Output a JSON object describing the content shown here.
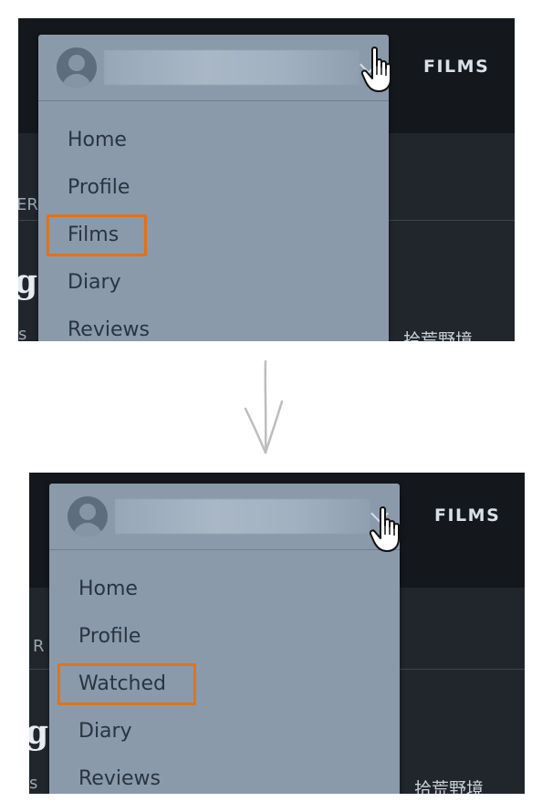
{
  "colors": {
    "highlight_outline": "#e0731a",
    "dropdown_background": "#8a9aab",
    "header_background": "#14181c",
    "arrow": "#bdbdbd"
  },
  "before": {
    "nav": {
      "films_label": "FILMS"
    },
    "background_fragments": {
      "left_edge_text": "ER",
      "big_glyph": "g",
      "small_text": "s",
      "cjk_text": "拾荒野境"
    },
    "account": {
      "avatar_icon": "user-avatar-icon",
      "chevron_icon": "chevron-down-icon"
    },
    "cursor_icon": "hand-pointer-icon",
    "menu": {
      "items": [
        {
          "label": "Home"
        },
        {
          "label": "Profile"
        },
        {
          "label": "Films",
          "highlighted": true
        },
        {
          "label": "Diary"
        },
        {
          "label": "Reviews"
        }
      ]
    }
  },
  "transition": {
    "arrow_icon": "arrow-down-icon"
  },
  "after": {
    "nav": {
      "films_label": "FILMS"
    },
    "background_fragments": {
      "left_edge_text": "R",
      "big_glyph": "g",
      "small_text": "s",
      "cjk_text": "拾荒野境"
    },
    "account": {
      "avatar_icon": "user-avatar-icon",
      "chevron_icon": "chevron-down-icon"
    },
    "cursor_icon": "hand-pointer-icon",
    "menu": {
      "items": [
        {
          "label": "Home"
        },
        {
          "label": "Profile"
        },
        {
          "label": "Watched",
          "highlighted": true
        },
        {
          "label": "Diary"
        },
        {
          "label": "Reviews"
        }
      ]
    }
  }
}
